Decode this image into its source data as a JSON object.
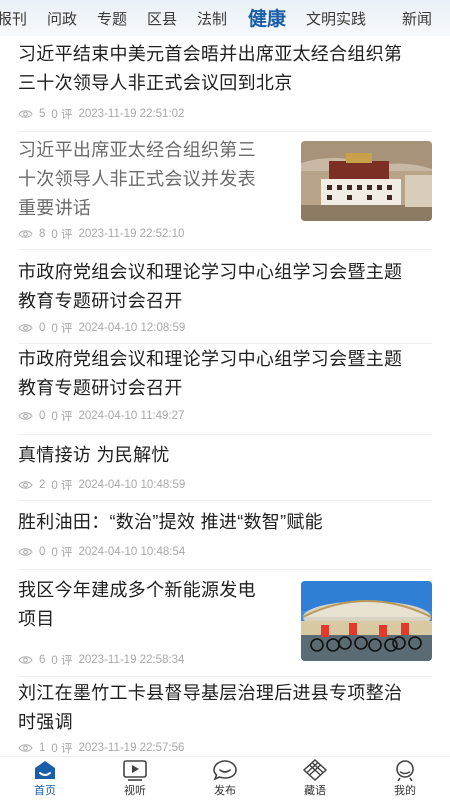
{
  "channels": [
    "报刊",
    "问政",
    "专题",
    "区县",
    "法制",
    "健康",
    "文明实践",
    "新闻"
  ],
  "active_channel": "健康",
  "articles": [
    {
      "title_lines": [
        "习近平结束中美元首会晤并出席亚太经合组织第",
        "三十次领导人非正式会议回到北京"
      ],
      "views": "5",
      "comments": "0 评",
      "time": "2023-11-19 22:51:02",
      "has_image": false
    },
    {
      "title_lines": [
        "习近平出席亚太经合组织第三",
        "十次领导人非正式会议并发表",
        "重要讲话"
      ],
      "views": "8",
      "comments": "0 评",
      "time": "2023-11-19 22:52:10",
      "has_image": true
    },
    {
      "title_lines": [
        "市政府党组会议和理论学习中心组学习会暨主题",
        "教育专题研讨会召开"
      ],
      "views": "0",
      "comments": "0 评",
      "time": "2024-04-10 12:08:59",
      "has_image": false
    },
    {
      "title_lines": [
        "市政府党组会议和理论学习中心组学习会暨主题",
        "教育专题研讨会召开"
      ],
      "views": "0",
      "comments": "0 评",
      "time": "2024-04-10 11:49:27",
      "has_image": false
    },
    {
      "title_lines": [
        "真情接访 为民解忧"
      ],
      "views": "2",
      "comments": "0 评",
      "time": "2024-04-10 10:48:59",
      "has_image": false
    },
    {
      "title_lines": [
        "胜利油田：“数治”提效 推进“数智”赋能"
      ],
      "views": "0",
      "comments": "0 评",
      "time": "2024-04-10 10:48:54",
      "has_image": false
    },
    {
      "title_lines": [
        "我区今年建成多个新能源发电",
        "项目"
      ],
      "views": "6",
      "comments": "0 评",
      "time": "2023-11-19 22:58:34",
      "has_image": true
    },
    {
      "title_lines": [
        "刘江在墨竹工卡县督导基层治理后进县专项整治",
        "时强调"
      ],
      "views": "1",
      "comments": "0 评",
      "time": "2023-11-19 22:57:56",
      "has_image": false
    }
  ],
  "tabs": [
    "首页",
    "视听",
    "发布",
    "藏语",
    "我的"
  ],
  "colors": {
    "accent": "#1a5da8",
    "meta": "#a8a8a8"
  }
}
